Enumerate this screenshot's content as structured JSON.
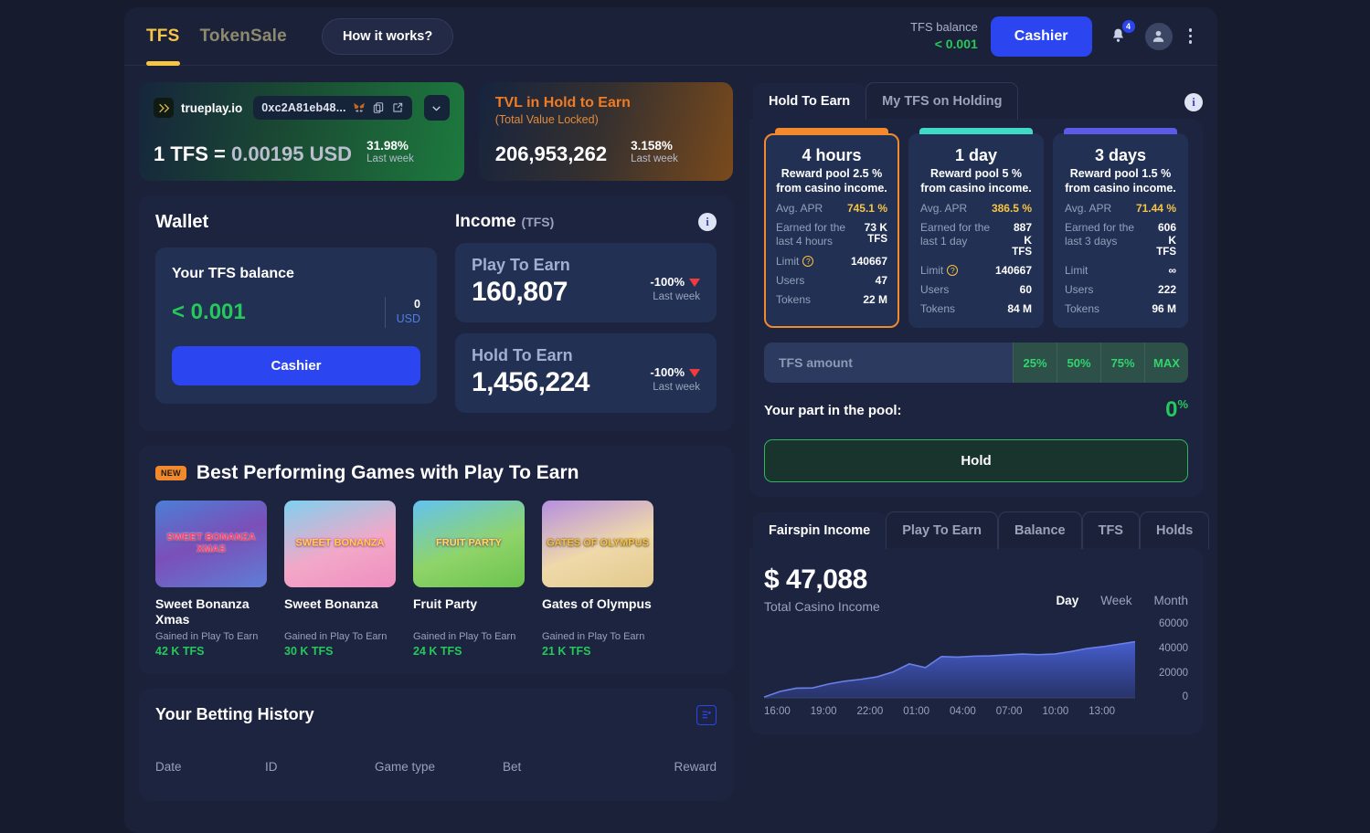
{
  "nav": {
    "tabs": [
      {
        "label": "TFS",
        "active": true
      },
      {
        "label": "TokenSale",
        "active": false
      }
    ],
    "how_it_works": "How it works?",
    "balance_label": "TFS balance",
    "balance_value": "< 0.001",
    "cashier_label": "Cashier",
    "notification_count": "4",
    "icons": [
      "bell-icon",
      "avatar-icon",
      "kebab-menu-icon"
    ],
    "accent_color": "#f6c544",
    "primary_color": "#2b46f0"
  },
  "trueplay": {
    "brand": "trueplay.io",
    "address": "0xc2A81eb48...",
    "wallet_icon": "metamask-fox-icon",
    "copy_icon": "copy-icon",
    "external_icon": "external-link-icon",
    "chevron_icon": "chevron-down-icon",
    "rate_prefix": "1 TFS = ",
    "rate_value": "0.00195 USD",
    "delta": "31.98%",
    "delta_label": "Last week"
  },
  "tvl": {
    "title": "TVL in Hold to Earn",
    "subtitle": "(Total Value Locked)",
    "value": "206,953,262",
    "delta": "3.158%",
    "delta_label": "Last week",
    "accent_color": "#f07b22"
  },
  "wallet": {
    "title": "Wallet",
    "balance_label": "Your TFS balance",
    "balance_value": "< 0.001",
    "usd_value": "0",
    "usd_label": "USD",
    "cashier_label": "Cashier"
  },
  "income": {
    "title": "Income",
    "unit": "(TFS)",
    "info_icon": "info-icon",
    "cards": [
      {
        "name": "Play To Earn",
        "value": "160,807",
        "delta": "-100%",
        "delta_label": "Last week"
      },
      {
        "name": "Hold To Earn",
        "value": "1,456,224",
        "delta": "-100%",
        "delta_label": "Last week"
      }
    ]
  },
  "games": {
    "badge": "NEW",
    "title": "Best Performing Games with Play To Earn",
    "items": [
      {
        "thumb_text": "SWEET BONANZA XMAS",
        "name": "Sweet Bonanza Xmas",
        "sub": "Gained in Play To Earn",
        "value": "42 K TFS"
      },
      {
        "thumb_text": "SWEET BONANZA",
        "name": "Sweet Bonanza",
        "sub": "Gained in Play To Earn",
        "value": "30 K TFS"
      },
      {
        "thumb_text": "FRUIT PARTY",
        "name": "Fruit Party",
        "sub": "Gained in Play To Earn",
        "value": "24 K TFS"
      },
      {
        "thumb_text": "GATES OF OLYMPUS",
        "name": "Gates of Olympus",
        "sub": "Gained in Play To Earn",
        "value": "21 K TFS"
      }
    ]
  },
  "history": {
    "title": "Your Betting History",
    "filter_icon": "list-filter-icon",
    "columns": [
      "Date",
      "ID",
      "Game type",
      "Bet",
      "Reward"
    ]
  },
  "hold": {
    "tabs": [
      {
        "label": "Hold To Earn",
        "active": true
      },
      {
        "label": "My TFS on Holding",
        "active": false
      }
    ],
    "info_icon": "info-icon",
    "pools": [
      {
        "duration": "4 hours",
        "desc": "Reward pool 2.5 % from casino income.",
        "apr_label": "Avg. APR",
        "apr": "745.1 %",
        "earned_label": "Earned for the last 4 hours",
        "earned": "73 K",
        "earned_unit": "TFS",
        "limit_label": "Limit",
        "limit": "140667",
        "limit_has_help": true,
        "users_label": "Users",
        "users": "47",
        "tokens_label": "Tokens",
        "tokens": "22 M",
        "bar_color": "#f2892c",
        "selected": true
      },
      {
        "duration": "1 day",
        "desc": "Reward pool 5 % from casino income.",
        "apr_label": "Avg. APR",
        "apr": "386.5 %",
        "earned_label": "Earned for the last 1 day",
        "earned": "887 K",
        "earned_unit": "TFS",
        "limit_label": "Limit",
        "limit": "140667",
        "limit_has_help": true,
        "users_label": "Users",
        "users": "60",
        "tokens_label": "Tokens",
        "tokens": "84 M",
        "bar_color": "#3fd9c8",
        "selected": false
      },
      {
        "duration": "3 days",
        "desc": "Reward pool 1.5 % from casino income.",
        "apr_label": "Avg. APR",
        "apr": "71.44 %",
        "earned_label": "Earned for the last 3 days",
        "earned": "606 K",
        "earned_unit": "TFS",
        "limit_label": "Limit",
        "limit": "∞",
        "limit_has_help": false,
        "users_label": "Users",
        "users": "222",
        "tokens_label": "Tokens",
        "tokens": "96 M",
        "bar_color": "#5b5be8",
        "selected": false
      }
    ],
    "amount_placeholder": "TFS amount",
    "amount_value": "",
    "percent_buttons": [
      "25%",
      "50%",
      "75%",
      "MAX"
    ],
    "part_label": "Your part in the pool:",
    "part_value": "0",
    "part_unit": "%",
    "hold_button": "Hold"
  },
  "fairspin": {
    "tabs": [
      {
        "label": "Fairspin Income",
        "active": true
      },
      {
        "label": "Play To Earn",
        "active": false
      },
      {
        "label": "Balance",
        "active": false
      },
      {
        "label": "TFS",
        "active": false
      },
      {
        "label": "Holds",
        "active": false
      }
    ],
    "total": "$ 47,088",
    "total_label": "Total Casino Income",
    "ranges": [
      {
        "label": "Day",
        "active": true
      },
      {
        "label": "Week",
        "active": false
      },
      {
        "label": "Month",
        "active": false
      }
    ]
  },
  "chart_data": {
    "type": "area",
    "title": "Total Casino Income",
    "xlabel": "",
    "ylabel": "",
    "ylim": [
      0,
      60000
    ],
    "yticks": [
      0,
      20000,
      40000,
      60000
    ],
    "grid": false,
    "legend": null,
    "line_color": "#4a62d8",
    "fill_color": "#3d52b8",
    "x": [
      "16:00",
      "17:00",
      "18:00",
      "19:00",
      "20:00",
      "21:00",
      "22:00",
      "23:00",
      "00:00",
      "01:00",
      "02:00",
      "03:00",
      "04:00",
      "05:00",
      "06:00",
      "07:00",
      "08:00",
      "09:00",
      "10:00",
      "11:00",
      "12:00",
      "13:00",
      "14:00",
      "15:00"
    ],
    "xtick_labels": [
      "16:00",
      "19:00",
      "22:00",
      "01:00",
      "04:00",
      "07:00",
      "10:00",
      "13:00"
    ],
    "values": [
      600,
      5200,
      7800,
      8000,
      11200,
      13500,
      15000,
      17000,
      21000,
      27500,
      24500,
      33500,
      33000,
      33800,
      34000,
      34800,
      35500,
      35000,
      35500,
      37500,
      40000,
      41500,
      43500,
      45500
    ],
    "series": [
      {
        "name": "Total Casino Income",
        "values": [
          600,
          5200,
          7800,
          8000,
          11200,
          13500,
          15000,
          17000,
          21000,
          27500,
          24500,
          33500,
          33000,
          33800,
          34000,
          34800,
          35500,
          35000,
          35500,
          37500,
          40000,
          41500,
          43500,
          45500
        ]
      }
    ]
  }
}
